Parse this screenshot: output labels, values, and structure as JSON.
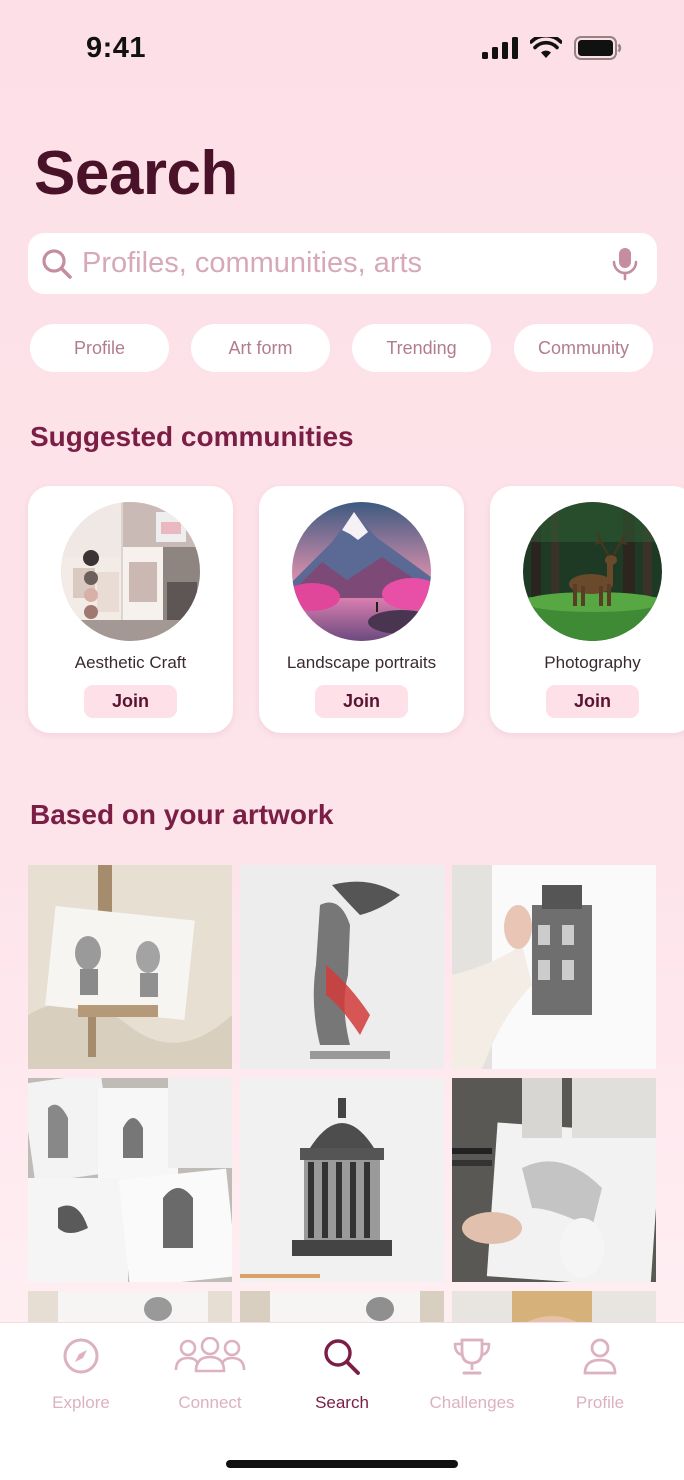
{
  "status_bar": {
    "time": "9:41",
    "icons": [
      "cellular-signal-icon",
      "wifi-icon",
      "battery-icon"
    ]
  },
  "page_title": "Search",
  "search": {
    "placeholder": "Profiles, communities, arts",
    "value": "",
    "icons": [
      "search-icon",
      "microphone-icon"
    ]
  },
  "filter_chips": [
    "Profile",
    "Art form",
    "Trending",
    "Community"
  ],
  "suggested": {
    "title": "Suggested communities",
    "join_label": "Join",
    "communities": [
      {
        "name": "Aesthetic Craft"
      },
      {
        "name": "Landscape portraits"
      },
      {
        "name": "Photography"
      }
    ]
  },
  "artwork": {
    "title": "Based on your artwork",
    "images": [
      "bust-sketches-on-easel",
      "winged-victory-drawing",
      "building-sketch-in-hands",
      "architecture-sketches-collage",
      "domed-temple-drawing",
      "artist-drawing-at-desk",
      "sketchbook-partial",
      "sketchbook-partial-2",
      "portrait-photo-partial"
    ]
  },
  "tab_bar": {
    "active": "Search",
    "tabs": [
      {
        "label": "Explore",
        "icon": "compass-icon"
      },
      {
        "label": "Connect",
        "icon": "people-group-icon"
      },
      {
        "label": "Search",
        "icon": "search-icon"
      },
      {
        "label": "Challenges",
        "icon": "trophy-icon"
      },
      {
        "label": "Profile",
        "icon": "person-icon"
      }
    ]
  },
  "colors": {
    "background": "#fde0e7",
    "title": "#4a1228",
    "accent": "#7a1e45",
    "chip_text": "#b27c8f",
    "inactive_tab": "#dcb1c0",
    "join_bg": "#fde0e8"
  }
}
